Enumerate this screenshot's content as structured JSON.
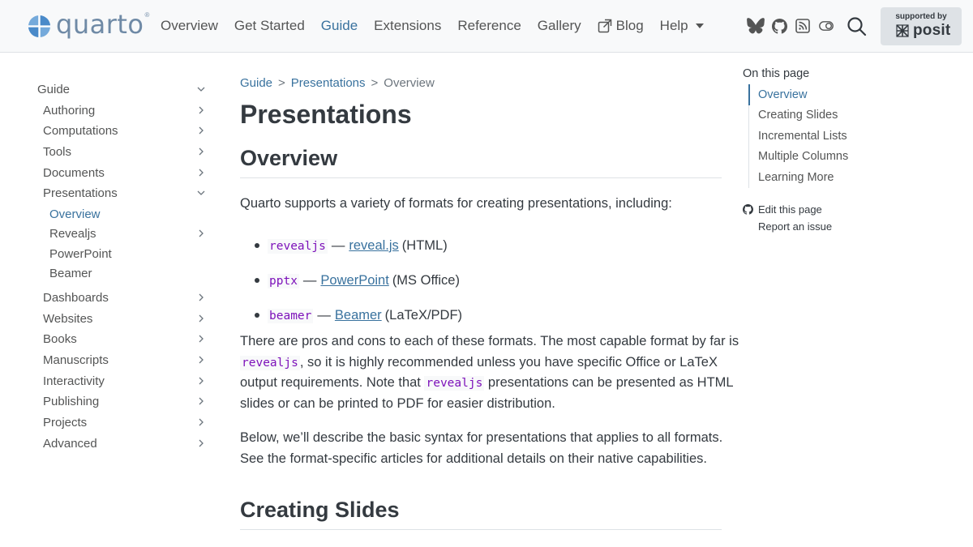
{
  "brand": {
    "name": "quarto"
  },
  "nav": {
    "links": [
      {
        "label": "Overview"
      },
      {
        "label": "Get Started"
      },
      {
        "label": "Guide",
        "active": true
      },
      {
        "label": "Extensions"
      },
      {
        "label": "Reference"
      },
      {
        "label": "Gallery"
      },
      {
        "label": "Blog",
        "icon": "external-link-icon"
      },
      {
        "label": "Help",
        "icon": "caret-down-icon"
      }
    ],
    "icons": [
      "bluesky-icon",
      "github-icon",
      "rss-icon",
      "toggle-icon",
      "search-icon"
    ],
    "sponsor": {
      "small": "supported by",
      "name": "posit"
    }
  },
  "sidebar": {
    "items": [
      {
        "label": "Guide",
        "chevron": "down"
      },
      {
        "label": "Authoring",
        "chevron": "right"
      },
      {
        "label": "Computations",
        "chevron": "right"
      },
      {
        "label": "Tools",
        "chevron": "right"
      },
      {
        "label": "Documents",
        "chevron": "right"
      },
      {
        "label": "Presentations",
        "chevron": "down"
      },
      {
        "label": "Overview",
        "active": true
      },
      {
        "label": "Revealjs",
        "chevron": "right"
      },
      {
        "label": "PowerPoint"
      },
      {
        "label": "Beamer"
      },
      {
        "label": "Dashboards",
        "chevron": "right"
      },
      {
        "label": "Websites",
        "chevron": "right"
      },
      {
        "label": "Books",
        "chevron": "right"
      },
      {
        "label": "Manuscripts",
        "chevron": "right"
      },
      {
        "label": "Interactivity",
        "chevron": "right"
      },
      {
        "label": "Publishing",
        "chevron": "right"
      },
      {
        "label": "Projects",
        "chevron": "right"
      },
      {
        "label": "Advanced",
        "chevron": "right"
      }
    ]
  },
  "breadcrumb": {
    "items": [
      "Guide",
      "Presentations",
      "Overview"
    ],
    "separator": ">"
  },
  "content": {
    "title": "Presentations",
    "overview_heading": "Overview",
    "intro": "Quarto supports a variety of formats for creating presentations, including:",
    "formats": [
      {
        "code": "revealjs",
        "dash": "—",
        "link": "reveal.js",
        "paren": "(HTML)"
      },
      {
        "code": "pptx",
        "dash": "—",
        "link": "PowerPoint",
        "paren": "(MS Office)"
      },
      {
        "code": "beamer",
        "dash": "—",
        "link": "Beamer",
        "paren": "(LaTeX/PDF)"
      }
    ],
    "pros": {
      "l1": "There are pros and cons to each of these formats. The most capable format by far is",
      "l2_code": "revealjs",
      "l2_text": ", so it is highly recommended unless you have specific Office or LaTeX",
      "l3_a": "output requirements. Note that",
      "l3_code": "revealjs",
      "l3_b": "presentations can be presented as HTML",
      "l4": "slides or can be printed to PDF for easier distribution."
    },
    "below": {
      "l1": "Below, we’ll describe the basic syntax for presentations that applies to all formats.",
      "l2": "See the format-specific articles for additional details on their native capabilities."
    },
    "creating_heading": "Creating Slides"
  },
  "toc": {
    "title": "On this page",
    "items": [
      {
        "label": "Overview",
        "active": true
      },
      {
        "label": "Creating Slides"
      },
      {
        "label": "Incremental Lists"
      },
      {
        "label": "Multiple Columns"
      },
      {
        "label": "Learning More"
      }
    ],
    "edit": "Edit this page",
    "report": "Report an issue"
  },
  "colors": {
    "accent": "#39729e",
    "text": "#343a40",
    "muted": "#545555",
    "code": "#7d12ba",
    "navbar_bg": "#f8f9fa",
    "badge_bg": "#dee2e6"
  }
}
